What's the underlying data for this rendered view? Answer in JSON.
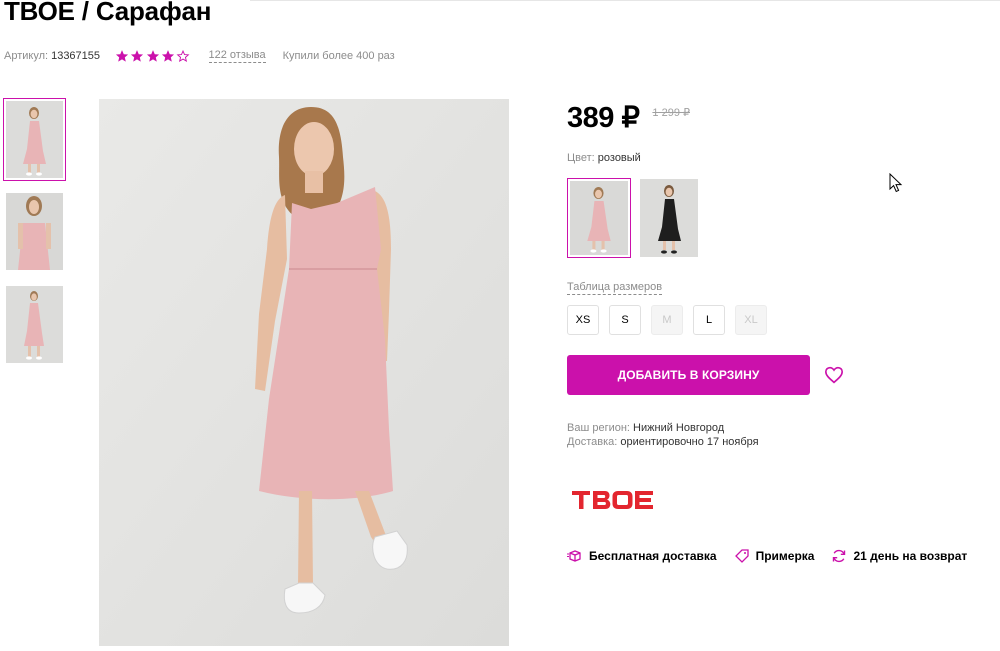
{
  "product": {
    "title": "ТВОЕ / Сарафан",
    "article_label": "Артикул:",
    "article_value": "13367155",
    "rating_stars": 4,
    "rating_max": 5,
    "reviews": "122 отзыва",
    "bought": "Купили более 400 раз"
  },
  "gallery": {
    "thumbnails": [
      "dress-photo-front",
      "dress-photo-closeup",
      "dress-photo-full"
    ],
    "active_index": 0
  },
  "pricing": {
    "price": "389 ₽",
    "old_price": "1 299 ₽"
  },
  "color": {
    "label": "Цвет:",
    "value": "розовый",
    "options": [
      "pink",
      "black"
    ],
    "active_index": 0
  },
  "sizes": {
    "table_link": "Таблица размеров",
    "options": [
      {
        "label": "XS",
        "available": true
      },
      {
        "label": "S",
        "available": true
      },
      {
        "label": "M",
        "available": false
      },
      {
        "label": "L",
        "available": true
      },
      {
        "label": "XL",
        "available": false
      }
    ]
  },
  "actions": {
    "add_to_cart": "ДОБАВИТЬ В КОРЗИНУ",
    "favorite_icon": "heart-icon"
  },
  "shipping": {
    "region_label": "Ваш регион:",
    "region_value": "Нижний Новгород",
    "delivery_label": "Доставка:",
    "delivery_value": "ориентировочно 17 ноября"
  },
  "brand": {
    "logo_text": "ТВОЕ"
  },
  "features": [
    {
      "icon": "box-icon",
      "label": "Бесплатная доставка"
    },
    {
      "icon": "tag-icon",
      "label": "Примерка"
    },
    {
      "icon": "refresh-icon",
      "label": "21 день на возврат"
    }
  ],
  "colors": {
    "accent": "#cb11ab",
    "brand_red": "#e3262f",
    "dress_pink": "#e8b4b6"
  }
}
